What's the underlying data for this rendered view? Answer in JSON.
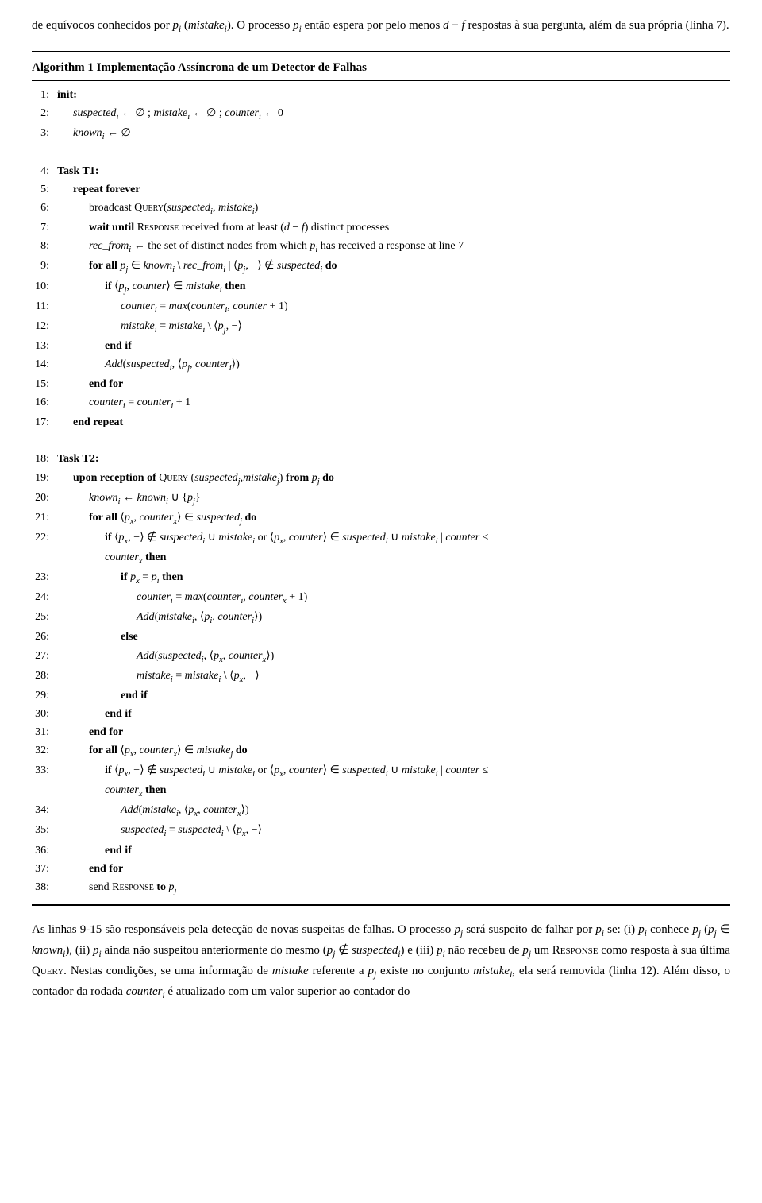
{
  "intro": {
    "text": "de equívocos conhecidos por p_i (mistake_i). O processo p_i então espera por pelo menos d − f respostas à sua pergunta, além da sua própria (linha 7)."
  },
  "algorithm": {
    "title": "Algorithm 1",
    "description": "Implementação Assíncrona de um Detector de Falhas",
    "lines": []
  },
  "body_text": {
    "paragraph1": "As linhas 9-15 são responsáveis pela detecção de novas suspeitas de falhas. O processo p_j será suspeito de falhar por p_i se: (i) p_i conhece p_j (p_j ∈ known_i), (ii) p_i ainda não suspeitou anteriormente do mesmo (p_j ∉ suspected_i) e (iii) p_i não recebeu de p_j um RESPONSE como resposta à sua última QUERY. Nestas condições, se uma informação de mistake referente a p_j existe no conjunto mistake_i, ela será removida (linha 12). Além disso, o contador da rodada counter_i é atualizado com um valor superior ao contador do"
  }
}
